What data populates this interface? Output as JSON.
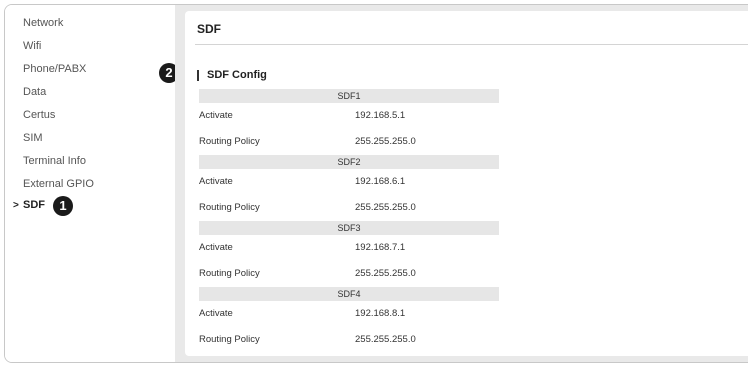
{
  "sidebar": {
    "items": [
      {
        "label": "Network"
      },
      {
        "label": "Wifi"
      },
      {
        "label": "Phone/PABX"
      },
      {
        "label": "Data"
      },
      {
        "label": "Certus"
      },
      {
        "label": "SIM"
      },
      {
        "label": "Terminal Info"
      },
      {
        "label": "External GPIO"
      },
      {
        "label": "SDF",
        "active": true
      }
    ],
    "chevron": ">"
  },
  "badges": {
    "one": "1",
    "two": "2"
  },
  "panel": {
    "title": "SDF",
    "section_title": "SDF Config"
  },
  "sdf": [
    {
      "name": "SDF1",
      "activate_label": "Activate",
      "activate_value": "192.168.5.1",
      "policy_label": "Routing Policy",
      "policy_value": "255.255.255.0"
    },
    {
      "name": "SDF2",
      "activate_label": "Activate",
      "activate_value": "192.168.6.1",
      "policy_label": "Routing Policy",
      "policy_value": "255.255.255.0"
    },
    {
      "name": "SDF3",
      "activate_label": "Activate",
      "activate_value": "192.168.7.1",
      "policy_label": "Routing Policy",
      "policy_value": "255.255.255.0"
    },
    {
      "name": "SDF4",
      "activate_label": "Activate",
      "activate_value": "192.168.8.1",
      "policy_label": "Routing Policy",
      "policy_value": "255.255.255.0"
    }
  ]
}
